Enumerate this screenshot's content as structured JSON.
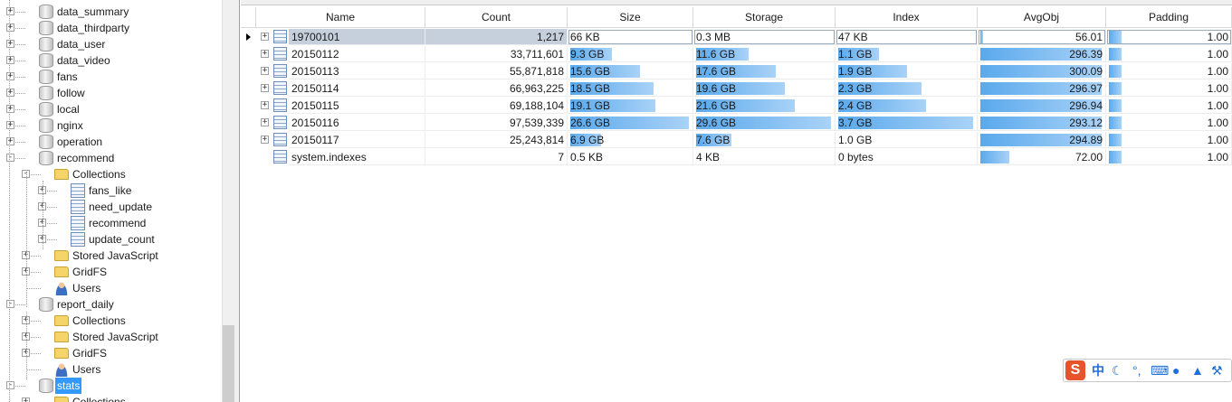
{
  "tree": {
    "nodes": [
      {
        "label": "data_summary",
        "icon": "database-icon",
        "depth": 0,
        "exp": "+"
      },
      {
        "label": "data_thirdparty",
        "icon": "database-icon",
        "depth": 0,
        "exp": "+"
      },
      {
        "label": "data_user",
        "icon": "database-icon",
        "depth": 0,
        "exp": "+"
      },
      {
        "label": "data_video",
        "icon": "database-icon",
        "depth": 0,
        "exp": "+"
      },
      {
        "label": "fans",
        "icon": "database-icon",
        "depth": 0,
        "exp": "+"
      },
      {
        "label": "follow",
        "icon": "database-icon",
        "depth": 0,
        "exp": "+"
      },
      {
        "label": "local",
        "icon": "database-icon",
        "depth": 0,
        "exp": "+"
      },
      {
        "label": "nginx",
        "icon": "database-icon",
        "depth": 0,
        "exp": "+"
      },
      {
        "label": "operation",
        "icon": "database-icon",
        "depth": 0,
        "exp": "+"
      },
      {
        "label": "recommend",
        "icon": "database-icon",
        "depth": 0,
        "exp": "-"
      },
      {
        "label": "Collections",
        "icon": "folder-icon",
        "depth": 1,
        "exp": "-"
      },
      {
        "label": "fans_like",
        "icon": "collection-icon",
        "depth": 2,
        "exp": "+"
      },
      {
        "label": "need_update",
        "icon": "collection-icon",
        "depth": 2,
        "exp": "+"
      },
      {
        "label": "recommend",
        "icon": "collection-icon",
        "depth": 2,
        "exp": "+"
      },
      {
        "label": "update_count",
        "icon": "collection-icon",
        "depth": 2,
        "exp": "+"
      },
      {
        "label": "Stored JavaScript",
        "icon": "folder-icon",
        "depth": 1,
        "exp": "+"
      },
      {
        "label": "GridFS",
        "icon": "folder-icon",
        "depth": 1,
        "exp": "+"
      },
      {
        "label": "Users",
        "icon": "users-icon",
        "depth": 1,
        "exp": ""
      },
      {
        "label": "report_daily",
        "icon": "database-icon",
        "depth": 0,
        "exp": "-"
      },
      {
        "label": "Collections",
        "icon": "folder-icon",
        "depth": 1,
        "exp": "+"
      },
      {
        "label": "Stored JavaScript",
        "icon": "folder-icon",
        "depth": 1,
        "exp": "+"
      },
      {
        "label": "GridFS",
        "icon": "folder-icon",
        "depth": 1,
        "exp": "+"
      },
      {
        "label": "Users",
        "icon": "users-icon",
        "depth": 1,
        "exp": ""
      },
      {
        "label": "stats",
        "icon": "database-icon",
        "depth": 0,
        "exp": "-",
        "selected": true
      },
      {
        "label": "Collections",
        "icon": "folder-icon",
        "depth": 1,
        "exp": "+"
      }
    ]
  },
  "grid": {
    "columns": [
      "Name",
      "Count",
      "Size",
      "Storage",
      "Index",
      "AvgObj",
      "Padding"
    ],
    "rows": [
      {
        "name": "19700101",
        "count": "1,217",
        "size": "66 KB",
        "storage": "0.3 MB",
        "index": "47 KB",
        "avgobj": "56.01",
        "padding": "1.00",
        "expandable": true,
        "selected": true,
        "bars": {
          "size": 0,
          "storage": 0,
          "index": 0,
          "avgobj": 0.02,
          "padding": 0.11
        }
      },
      {
        "name": "20150112",
        "count": "33,711,601",
        "size": "9.3 GB",
        "storage": "11.6 GB",
        "index": "1.1 GB",
        "avgobj": "296.39",
        "padding": "1.00",
        "expandable": true,
        "bars": {
          "size": 0.35,
          "storage": 0.39,
          "index": 0.3,
          "avgobj": 1.0,
          "padding": 0.11
        }
      },
      {
        "name": "20150113",
        "count": "55,871,818",
        "size": "15.6 GB",
        "storage": "17.6 GB",
        "index": "1.9 GB",
        "avgobj": "300.09",
        "padding": "1.00",
        "expandable": true,
        "bars": {
          "size": 0.59,
          "storage": 0.59,
          "index": 0.51,
          "avgobj": 1.0,
          "padding": 0.11
        }
      },
      {
        "name": "20150114",
        "count": "66,963,225",
        "size": "18.5 GB",
        "storage": "19.6 GB",
        "index": "2.3 GB",
        "avgobj": "296.97",
        "padding": "1.00",
        "expandable": true,
        "bars": {
          "size": 0.7,
          "storage": 0.66,
          "index": 0.62,
          "avgobj": 1.0,
          "padding": 0.11
        }
      },
      {
        "name": "20150115",
        "count": "69,188,104",
        "size": "19.1 GB",
        "storage": "21.6 GB",
        "index": "2.4 GB",
        "avgobj": "296.94",
        "padding": "1.00",
        "expandable": true,
        "bars": {
          "size": 0.72,
          "storage": 0.73,
          "index": 0.65,
          "avgobj": 1.0,
          "padding": 0.11
        }
      },
      {
        "name": "20150116",
        "count": "97,539,339",
        "size": "26.6 GB",
        "storage": "29.6 GB",
        "index": "3.7 GB",
        "avgobj": "293.12",
        "padding": "1.00",
        "expandable": true,
        "bars": {
          "size": 1.0,
          "storage": 1.0,
          "index": 1.0,
          "avgobj": 1.0,
          "padding": 0.11
        }
      },
      {
        "name": "20150117",
        "count": "25,243,814",
        "size": "6.9 GB",
        "storage": "7.6 GB",
        "index": "1.0 GB",
        "avgobj": "294.89",
        "padding": "1.00",
        "expandable": true,
        "bars": {
          "size": 0.26,
          "storage": 0.26,
          "index": 0,
          "avgobj": 1.0,
          "padding": 0.11
        }
      },
      {
        "name": "system.indexes",
        "count": "7",
        "size": "0.5 KB",
        "storage": "4 KB",
        "index": "0 bytes",
        "avgobj": "72.00",
        "padding": "1.00",
        "expandable": false,
        "bars": {
          "size": 0,
          "storage": 0,
          "index": 0,
          "avgobj": 0.24,
          "padding": 0.11
        }
      }
    ]
  },
  "ime": {
    "logo": "S",
    "mode": "中",
    "items": [
      "moon-icon",
      "punctuation-icon",
      "keyboard-icon",
      "user-icon",
      "skin-icon",
      "wrench-icon"
    ],
    "accent": "#e8532b",
    "icon_color": "#1e6fd8"
  }
}
